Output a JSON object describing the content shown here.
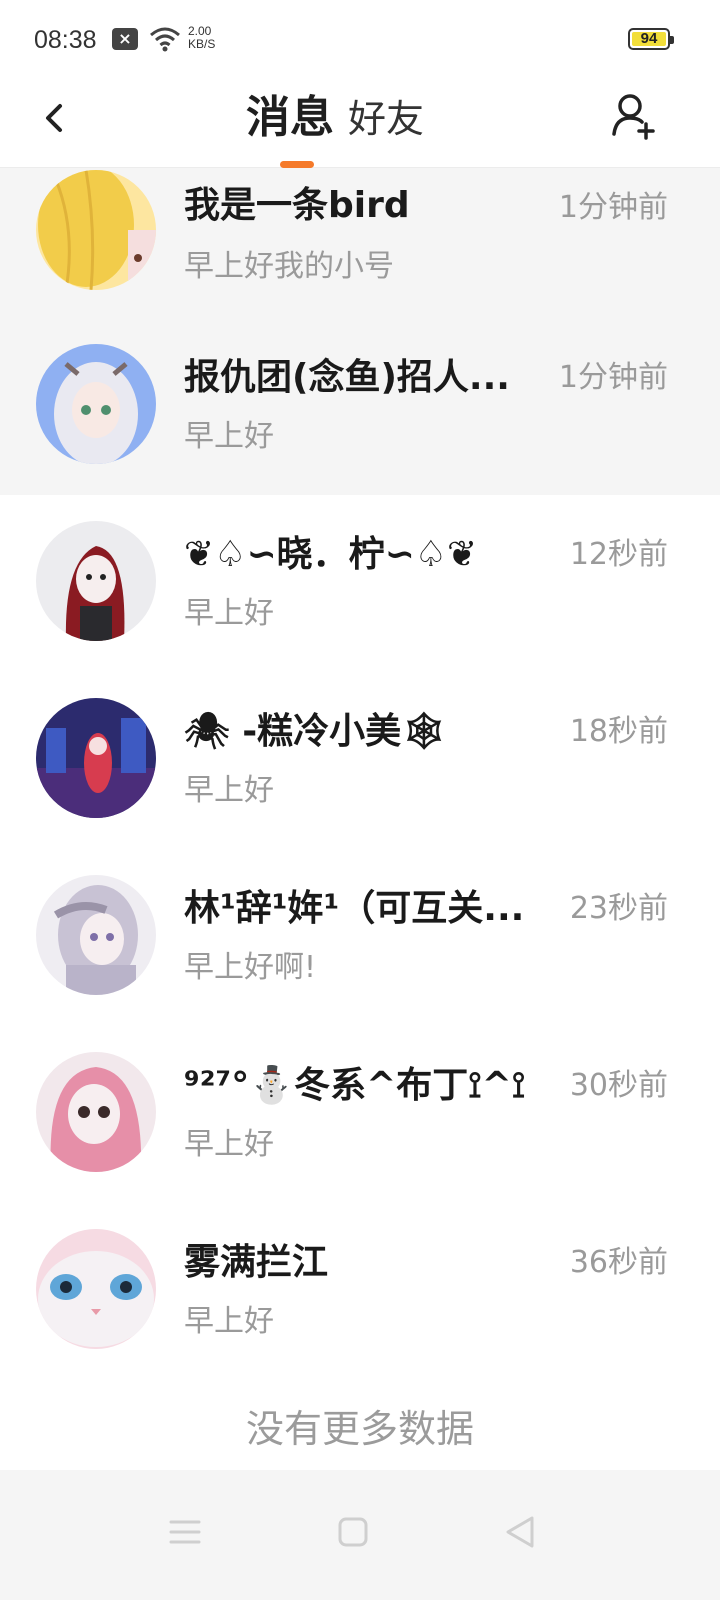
{
  "status_bar": {
    "time": "08:38",
    "net_speed_value": "2.00",
    "net_speed_unit": "KB/S",
    "battery": "94",
    "battery_color": "#f2de3a"
  },
  "header": {
    "tab_messages": "消息",
    "tab_friends": "好友",
    "accent_color": "#f57a2a",
    "back_icon": "chevron-left-icon",
    "add_friend_icon": "add-user-icon"
  },
  "conversations": [
    {
      "name": "我是一条bird",
      "preview": "早上好我的小号",
      "time": "1分钟前",
      "pinned": true,
      "avatar_colors": [
        "#f6d35a",
        "#e8a33a"
      ]
    },
    {
      "name": "报仇团(念鱼)招人...",
      "preview": "早上好",
      "time": "1分钟前",
      "pinned": true,
      "avatar_colors": [
        "#7ea6f0",
        "#e6e6ee"
      ]
    },
    {
      "name": "❦♤∽晓．柠∽♤❦",
      "preview": "早上好",
      "time": "12秒前",
      "pinned": false,
      "avatar_colors": [
        "#e8e8ec",
        "#8c1d22"
      ]
    },
    {
      "name": "🕷 -糕冷小美🕸",
      "preview": "早上好",
      "time": "18秒前",
      "pinned": false,
      "avatar_colors": [
        "#2c2b6e",
        "#c8365b"
      ]
    },
    {
      "name": "林¹辞¹姩¹（可互关...",
      "preview": "早上好啊!",
      "time": "23秒前",
      "pinned": false,
      "avatar_colors": [
        "#ece8ef",
        "#b9b3c9"
      ]
    },
    {
      "name": "⁹²⁷°⛄冬系^布丁⟟^⟟",
      "preview": "早上好",
      "time": "30秒前",
      "pinned": false,
      "avatar_colors": [
        "#f2e6ea",
        "#e68fa8"
      ]
    },
    {
      "name": "雾满拦江",
      "preview": "早上好",
      "time": "36秒前",
      "pinned": false,
      "avatar_colors": [
        "#f6d9e2",
        "#5fa6d8"
      ]
    }
  ],
  "end_text": "没有更多数据",
  "nav": {
    "menu_icon": "menu-icon",
    "home_icon": "home-square-icon",
    "back_icon": "back-triangle-icon"
  }
}
